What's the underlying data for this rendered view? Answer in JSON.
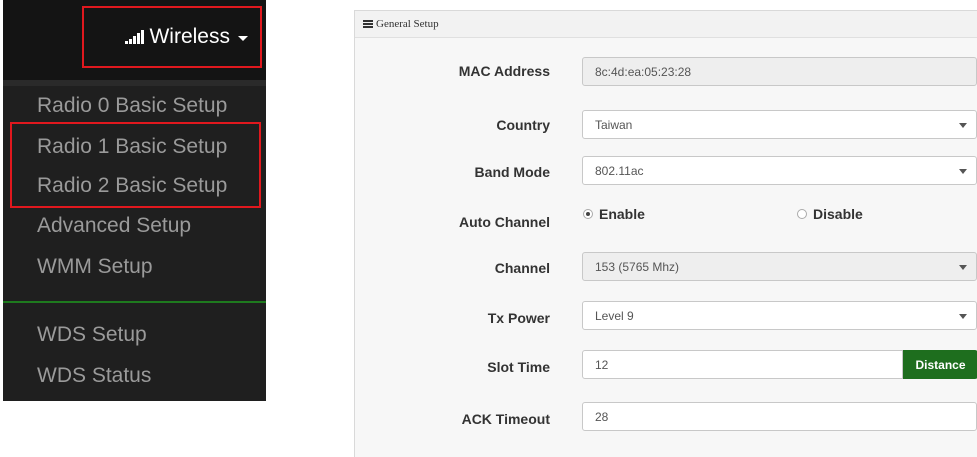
{
  "menu": {
    "title": "Wireless",
    "items": [
      {
        "label": "Radio 0 Basic Setup"
      },
      {
        "label": "Radio 1 Basic Setup"
      },
      {
        "label": "Radio 2 Basic Setup"
      },
      {
        "label": "Advanced Setup"
      },
      {
        "label": "WMM Setup"
      },
      {
        "label": "WDS Setup"
      },
      {
        "label": "WDS Status"
      }
    ],
    "highlight_color": "#e0181e",
    "divider_color": "#1e7a1e",
    "icon": "signal-bars-icon"
  },
  "form": {
    "header": "General Setup",
    "header_icon": "list-icon",
    "mac_label": "MAC Address",
    "mac_value": "8c:4d:ea:05:23:28",
    "country_label": "Country",
    "country_value": "Taiwan",
    "band_label": "Band Mode",
    "band_value": "802.11ac",
    "auto_channel_label": "Auto Channel",
    "auto_channel_enable": "Enable",
    "auto_channel_disable": "Disable",
    "auto_channel_selected": "Enable",
    "channel_label": "Channel",
    "channel_value": "153 (5765 Mhz)",
    "tx_power_label": "Tx Power",
    "tx_power_value": "Level 9",
    "slot_time_label": "Slot Time",
    "slot_time_value": "12",
    "distance_button": "Distance",
    "ack_label": "ACK Timeout",
    "ack_value": "28",
    "accent_color": "#1e6e1e"
  }
}
